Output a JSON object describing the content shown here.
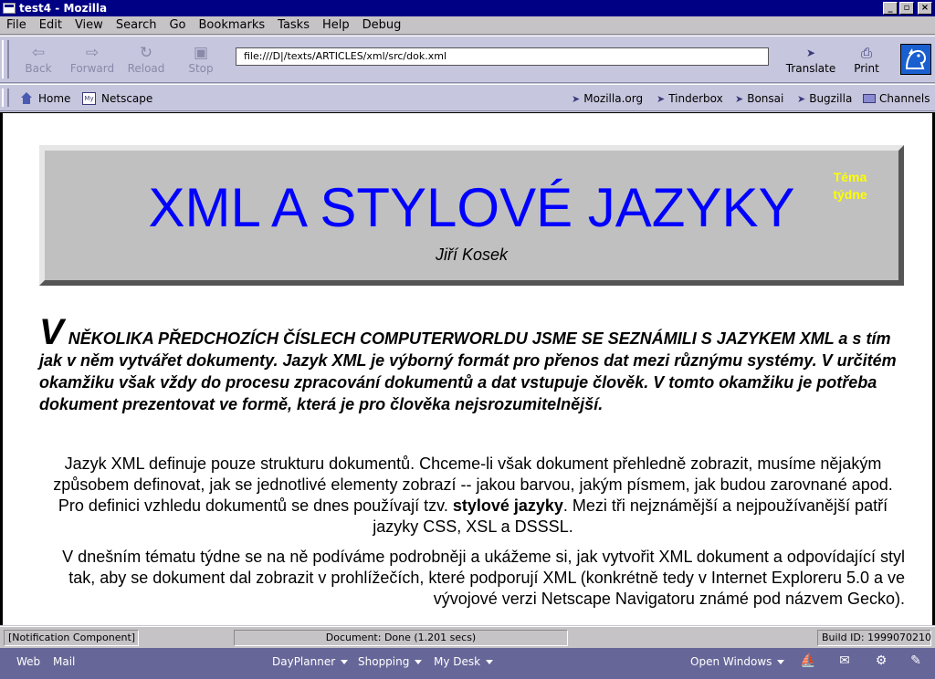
{
  "window": {
    "title": "test4 - Mozilla"
  },
  "menu": [
    "File",
    "Edit",
    "View",
    "Search",
    "Go",
    "Bookmarks",
    "Tasks",
    "Help",
    "Debug"
  ],
  "nav": {
    "back": "Back",
    "forward": "Forward",
    "reload": "Reload",
    "stop": "Stop",
    "url": "file:///D|/texts/ARTICLES/xml/src/dok.xml",
    "translate": "Translate",
    "print": "Print"
  },
  "personal": {
    "home": "Home",
    "netscape": "Netscape",
    "mozilla": "Mozilla.org",
    "tinderbox": "Tinderbox",
    "bonsai": "Bonsai",
    "bugzilla": "Bugzilla",
    "channels": "Channels"
  },
  "page": {
    "title": "XML A STYLOVÉ JAZYKY",
    "author": "Jiří Kosek",
    "tag_line1": "Téma",
    "tag_line2": "týdne",
    "lead_dropcap": "V",
    "lead_caps": " několika předchozích číslech Computerworldu jsme se seznámili s jazykem",
    "lead_rest": "XML a s tím jak v něm vytvářet dokumenty. Jazyk XML je výborný formát pro přenos dat mezi různýmu systémy. V určitém okamžiku však vždy do procesu zpracování dokumentů a dat vstupuje člověk. V tomto okamžiku je potřeba dokument prezentovat ve formě, která je pro člověka nejsrozumitelnější.",
    "p1_before": "Jazyk XML definuje pouze strukturu dokumentů. Chceme-li však dokument přehledně zobrazit, musíme nějakým způsobem definovat, jak se jednotlivé elementy zobrazí -- jakou barvou, jakým písmem, jak budou zarovnané apod. Pro definici vzhledu dokumentů se dnes používají tzv. ",
    "p1_bold": "stylové jazyky",
    "p1_after": ". Mezi tři nejznámější a nejpoužívanější patří jazyky CSS, XSL a DSSSL.",
    "p2": "V dnešním tématu týdne se na ně podíváme podrobněji a ukážeme si, jak vytvořit XML dokument a odpovídající styl tak, aby se dokument dal zobrazit v prohlížečích, které podporují XML (konkrétně tedy v Internet Exploreru 5.0 a ve vývojové verzi Netscape Navigatoru známé pod názvem Gecko)."
  },
  "status": {
    "component": "[Notification Component]",
    "done": "Document: Done (1.201 secs)",
    "build": "Build ID: 1999070210"
  },
  "taskbar": {
    "web": "Web",
    "mail": "Mail",
    "dayplanner": "DayPlanner",
    "shopping": "Shopping",
    "mydesk": "My Desk",
    "openwindows": "Open Windows"
  }
}
